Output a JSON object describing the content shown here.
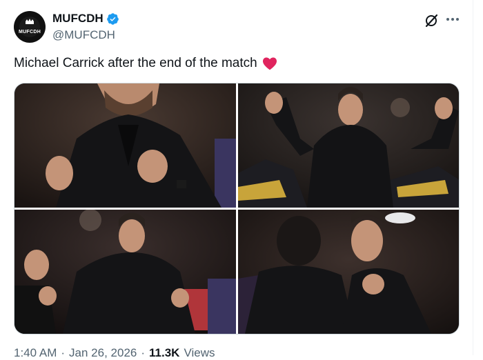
{
  "author": {
    "display_name": "MUFCDH",
    "handle": "@MUFCDH",
    "avatar_text": "MUFCDH",
    "verified": true,
    "verified_color": "#1d9bf0"
  },
  "header_actions": {
    "grok_icon": "grok-slash-circle-icon",
    "more_icon": "more-horizontal-icon"
  },
  "tweet": {
    "text": "Michael Carrick after the end of the match",
    "emoji": "heart-red-icon",
    "emoji_color": "#e0245e"
  },
  "media": {
    "layout": "2x2-grid",
    "photos": [
      "photo-1",
      "photo-2",
      "photo-3",
      "photo-4"
    ]
  },
  "meta": {
    "time": "1:40 AM",
    "separator": "·",
    "date": "Jan 26, 2026",
    "views_count": "11.3K",
    "views_label": "Views"
  },
  "colors": {
    "text_primary": "#0f1419",
    "text_secondary": "#536471",
    "border": "#cfd9de"
  }
}
